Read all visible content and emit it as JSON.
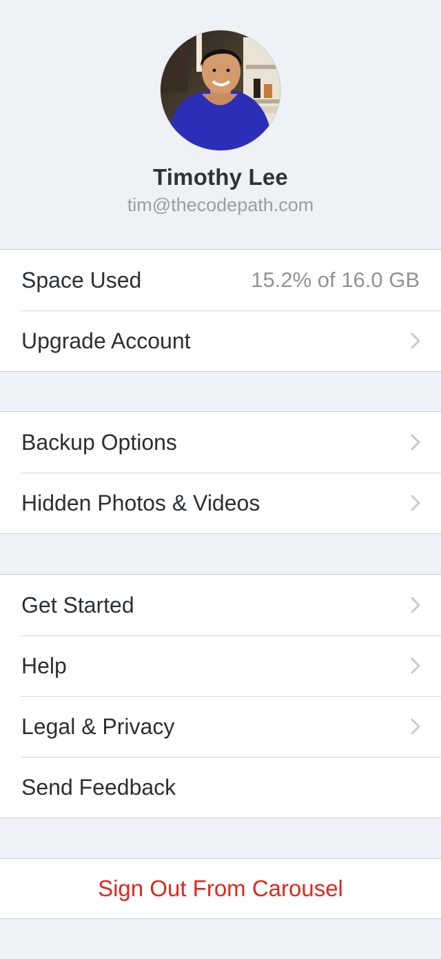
{
  "profile": {
    "name": "Timothy Lee",
    "email": "tim@thecodepath.com"
  },
  "account": {
    "space_used_label": "Space Used",
    "space_used_value": "15.2% of 16.0 GB",
    "upgrade_label": "Upgrade Account"
  },
  "photos": {
    "backup_label": "Backup Options",
    "hidden_label": "Hidden Photos & Videos"
  },
  "support": {
    "get_started_label": "Get Started",
    "help_label": "Help",
    "legal_label": "Legal & Privacy",
    "feedback_label": "Send Feedback"
  },
  "signout": {
    "label": "Sign Out From Carousel"
  },
  "icons": {
    "chevron": "chevron-right-icon",
    "avatar": "profile-photo"
  },
  "colors": {
    "background": "#eef1f5",
    "destructive": "#e2261f",
    "secondary_text": "#9a9ea3",
    "chevron": "#c7c9cc"
  }
}
